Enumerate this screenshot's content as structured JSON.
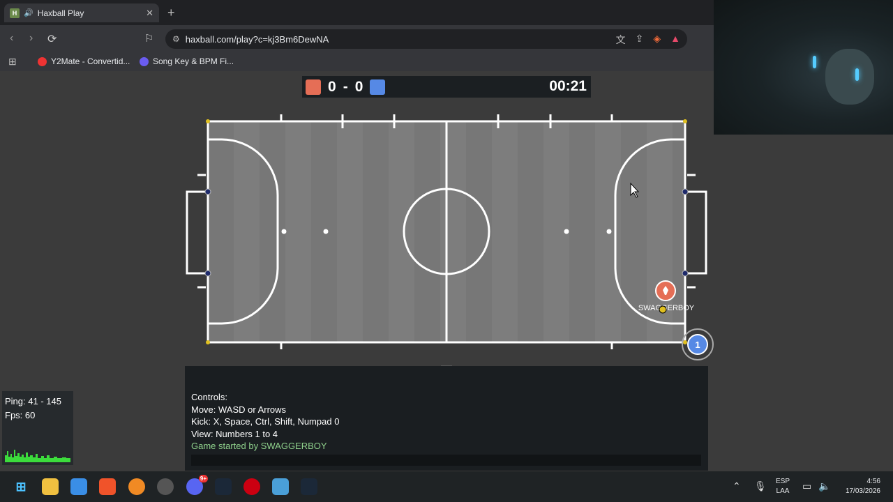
{
  "browser": {
    "tab_title": "Haxball Play",
    "tab_favicon": "H",
    "new_tab_label": "+",
    "url": "haxball.com/play?c=kj3Bm6DewNA",
    "bookmarks": [
      "Y2Mate - Convertid...",
      "Song Key & BPM Fi..."
    ],
    "brave_badge": "2"
  },
  "game": {
    "red_score": "0",
    "separator": "-",
    "blue_score": "0",
    "timer": "00:21",
    "red_color": "#e56e56",
    "blue_color": "#5689e5",
    "player_name": "SWAGGERBOY",
    "blue_player_number": "1"
  },
  "chat": {
    "lines": [
      "Controls:",
      "Move: WASD or Arrows",
      "Kick: X, Space, Ctrl, Shift, Numpad 0",
      "View: Numbers 1 to 4"
    ],
    "system_message": "Game started by SWAGGERBOY"
  },
  "stats": {
    "ping": "Ping: 41 - 145",
    "fps": "Fps: 60"
  },
  "taskbar": {
    "lang_top": "ESP",
    "lang_bottom": "LAA",
    "time": "4:56",
    "date": "17/03/2026",
    "discord_badge": "9+"
  }
}
